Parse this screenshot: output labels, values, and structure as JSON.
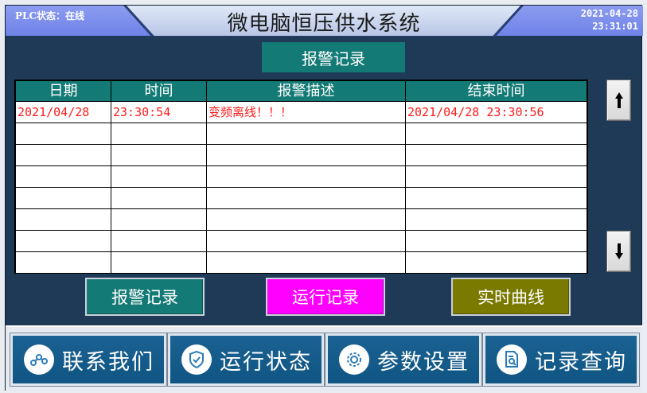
{
  "header": {
    "plc_status": "PLC状态：在线",
    "title": "微电脑恒压供水系统",
    "date": "2021-04-28",
    "time": "23:31:01"
  },
  "page": {
    "title": "报警记录"
  },
  "alarm_table": {
    "columns": [
      "日期",
      "时间",
      "报警描述",
      "结束时间"
    ],
    "rows": [
      [
        "2021/04/28",
        "23:30:54",
        "变频离线！！！",
        "2021/04/28 23:30:56"
      ],
      [
        "",
        "",
        "",
        ""
      ],
      [
        "",
        "",
        "",
        ""
      ],
      [
        "",
        "",
        "",
        ""
      ],
      [
        "",
        "",
        "",
        ""
      ],
      [
        "",
        "",
        "",
        ""
      ],
      [
        "",
        "",
        "",
        ""
      ],
      [
        "",
        "",
        "",
        ""
      ]
    ],
    "text_color": "#ff1a1a"
  },
  "scroll": {
    "up_icon": "arrow-up-icon",
    "down_icon": "arrow-down-icon"
  },
  "actions": {
    "alarm_label": "报警记录",
    "run_label": "运行记录",
    "curve_label": "实时曲线",
    "alarm_color": "#137a76",
    "run_color": "#ff00ff",
    "curve_color": "#7a7a00"
  },
  "nav": [
    {
      "label": "联系我们",
      "icon": "share-network-icon"
    },
    {
      "label": "运行状态",
      "icon": "shield-check-icon"
    },
    {
      "label": "参数设置",
      "icon": "gear-icon"
    },
    {
      "label": "记录查询",
      "icon": "document-search-icon"
    }
  ]
}
